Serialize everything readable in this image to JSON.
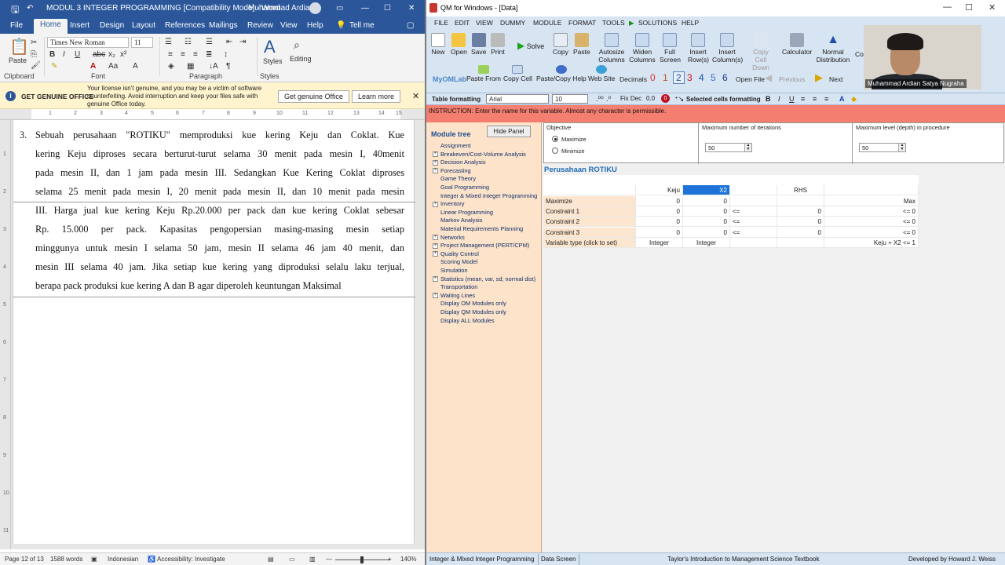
{
  "word": {
    "title": "MODUL 3 INTEGER PROGRAMMING [Compatibility Mode]  -  Word",
    "user": "Muhammad Ardian",
    "tabs": [
      "File",
      "Home",
      "Insert",
      "Design",
      "Layout",
      "References",
      "Mailings",
      "Review",
      "View",
      "Help",
      "Tell me"
    ],
    "ribbon": {
      "paste": "Paste",
      "font_name": "Times New Roman",
      "font_size": "11",
      "styles": "Styles",
      "editing": "Editing",
      "groups": [
        "Clipboard",
        "Font",
        "Paragraph",
        "Styles"
      ]
    },
    "banner": {
      "title": "GET GENUINE OFFICE",
      "message": "Your license isn't genuine, and you may be a victim of software counterfeiting. Avoid interruption and keep your files safe with genuine Office today.",
      "btn_primary": "Get genuine Office",
      "btn_secondary": "Learn more"
    },
    "doc": {
      "number": "3.",
      "lines": [
        "Sebuah perusahaan \"ROTIKU\" memproduksi kue kering Keju dan Coklat.  Kue",
        "kering Keju diproses secara berturut-turut selama 30 menit pada mesin I, 40menit",
        "pada mesin II, dan 1 jam pada mesin III. Sedangkan Kue Kering Coklat diproses",
        "selama 25 menit pada mesin I, 20 menit pada mesin II, dan 10 menit pada mesin",
        "III. Harga jual kue kering Keju Rp.20.000 per pack dan kue  kering Coklat sebesar",
        "Rp. 15.000 per pack. Kapasitas pengopersian masing-masing mesin setiap",
        "minggunya untuk mesin I selama 50 jam, mesin II selama 46 jam 40 menit,  dan",
        "mesin III selama 40 jam. Jika setiap kue kering yang diproduksi selalu laku terjual,",
        "berapa pack produksi kue kering A dan B agar diperoleh keuntungan Maksimal"
      ]
    },
    "status": {
      "page": "Page 12 of 13",
      "words": "1588 words",
      "language": "Indonesian",
      "accessibility": "Accessibility: Investigate",
      "zoom": "140%"
    }
  },
  "qm": {
    "title": "QM for Windows - [Data]",
    "menu": [
      "FILE",
      "EDIT",
      "VIEW",
      "DUMMY",
      "MODULE",
      "FORMAT",
      "TOOLS",
      "SOLUTIONS",
      "HELP"
    ],
    "toolbar": [
      "New",
      "Open",
      "Save",
      "Print",
      "Solve",
      "Copy",
      "Paste",
      "Autosize Columns",
      "Widen Columns",
      "Full Screen",
      "Insert Row(s)",
      "Insert Column(s)",
      "Copy Cell Down",
      "Calculator",
      "Normal Distribution",
      "Co"
    ],
    "toolbar2": {
      "myomlab": "MyOMLab",
      "paste_from": "Paste From",
      "copy_cell": "Copy Cell",
      "paste_copy_help": "Paste/Copy Help",
      "web_site": "Web Site",
      "decimals": "Decimals",
      "decimal_digits": [
        "0",
        "1",
        "2",
        "3",
        "4",
        "5",
        "6"
      ],
      "open_file": "Open File",
      "previous": "Previous",
      "next": "Next"
    },
    "format_bar": {
      "label": "Table formatting",
      "font": "Arial",
      "size": "10",
      "fix_dec": "Fix Dec",
      "fix_val": "0.0",
      "selected_label": "Selected cells formatting"
    },
    "instruction": "INSTRUCTION:  Enter the name for this variable. Almost any character is permissible.",
    "tree": {
      "header": "Module tree",
      "hide_btn": "Hide Panel",
      "items": [
        {
          "label": "Assignment",
          "expand": false
        },
        {
          "label": "Breakeven/Cost-Volume Analysis",
          "expand": true
        },
        {
          "label": "Decision Analysis",
          "expand": true
        },
        {
          "label": "Forecasting",
          "expand": true
        },
        {
          "label": "Game Theory",
          "expand": false
        },
        {
          "label": "Goal Programming",
          "expand": false
        },
        {
          "label": "Integer & Mixed Integer Programming",
          "expand": false
        },
        {
          "label": "Inventory",
          "expand": true
        },
        {
          "label": "Linear Programming",
          "expand": false
        },
        {
          "label": "Markov Analysis",
          "expand": false
        },
        {
          "label": "Material Requirements Planning",
          "expand": false
        },
        {
          "label": "Networks",
          "expand": true
        },
        {
          "label": "Project Management (PERT/CPM)",
          "expand": true
        },
        {
          "label": "Quality Control",
          "expand": true
        },
        {
          "label": "Scoring Model",
          "expand": false
        },
        {
          "label": "Simulation",
          "expand": false
        },
        {
          "label": "Statistics (mean, var, sd; normal dist)",
          "expand": true
        },
        {
          "label": "Transportation",
          "expand": false
        },
        {
          "label": "Waiting Lines",
          "expand": true
        },
        {
          "label": "Display OM Modules only",
          "expand": false
        },
        {
          "label": "Display QM Modules only",
          "expand": false
        },
        {
          "label": "Display ALL Modules",
          "expand": false
        }
      ]
    },
    "objective": {
      "label": "Objective",
      "maximize": "Maximize",
      "minimize": "Minimize",
      "max_iter_label": "Maximum number of iterations",
      "max_iter": "50",
      "max_level_label": "Maximum level (depth) in procedure",
      "max_level": "50"
    },
    "problem_title": "Perusahaan ROTIKU",
    "grid": {
      "headers": [
        "",
        "Keju",
        "X2",
        "",
        "RHS",
        ""
      ],
      "rows": [
        [
          "Maximize",
          "0",
          "0",
          "",
          "",
          "Max"
        ],
        [
          "Constraint 1",
          "0",
          "0",
          "<=",
          "0",
          "<= 0"
        ],
        [
          "Constraint 2",
          "0",
          "0",
          "<=",
          "0",
          "<= 0"
        ],
        [
          "Constraint 3",
          "0",
          "0",
          "<=",
          "0",
          "<= 0"
        ],
        [
          "Variable type (click to set)",
          "Integer",
          "Integer",
          "",
          "",
          "Keju + X2 <= 1"
        ]
      ]
    },
    "status": {
      "module": "Integer & Mixed Integer Programming",
      "screen": "Data Screen",
      "book": "Taylor's Introduction to Management Science Textbook",
      "dev": "Developed by Howard J. Weiss"
    },
    "webcam_name": "Muhammad Ardian Satya Nugraha"
  }
}
